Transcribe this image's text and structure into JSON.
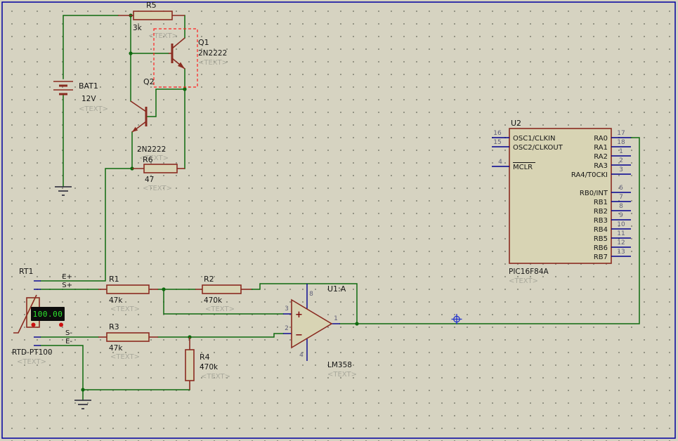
{
  "canvas": {
    "background": "#d6d3c1",
    "sheet_border_color": "#0000a0",
    "wire_color": "#0f6b0f",
    "component_color": "#8a2b20",
    "pin_color": "#00008f",
    "selection_color": "#ff2020",
    "origin_marker_color": "#2233cc",
    "lcd_text_color": "#2de52d"
  },
  "components": {
    "r5": {
      "ref": "R5",
      "value": "3k",
      "annotation": "<TEXT>"
    },
    "q1": {
      "ref": "Q1",
      "value": "2N2222",
      "annotation": "<TEXT>"
    },
    "q2": {
      "ref": "Q2",
      "value": "2N2222",
      "annotation": "<TEXT>"
    },
    "bat1": {
      "ref": "BAT1",
      "value": "12V",
      "annotation": "<TEXT>"
    },
    "r6": {
      "ref": "R6",
      "value": "47",
      "annotation": "<TEXT>"
    },
    "r1": {
      "ref": "R1",
      "value": "47k",
      "annotation": "<TEXT>"
    },
    "r2": {
      "ref": "R2",
      "value": "470k",
      "annotation": "<TEXT>"
    },
    "r3": {
      "ref": "R3",
      "value": "47k",
      "annotation": "<TEXT>"
    },
    "r4": {
      "ref": "R4",
      "value": "470k",
      "annotation": "<TEXT>"
    },
    "rt1": {
      "ref": "RT1",
      "value": "RTD-PT100",
      "annotation": "<TEXT>",
      "display_value": "100.00",
      "pins": {
        "ep": "E+",
        "sp": "S+",
        "sm": "S-",
        "em": "E-"
      }
    },
    "u1": {
      "ref": "U1:A",
      "value": "LM358",
      "annotation": "<TEXT>",
      "plus": "+",
      "minus": "−",
      "pin_numbers": {
        "noninv": "3",
        "inv": "2",
        "out": "1",
        "vcc": "8",
        "vee": "4"
      }
    },
    "u2": {
      "ref": "U2",
      "value": "PIC16F84A",
      "annotation": "<TEXT>",
      "left_pins": [
        {
          "num": "16",
          "name": "OSC1/CLKIN"
        },
        {
          "num": "15",
          "name": "OSC2/CLKOUT"
        },
        {
          "num": "4",
          "name": "MCLR"
        }
      ],
      "right_pins": [
        {
          "num": "17",
          "name": "RA0"
        },
        {
          "num": "18",
          "name": "RA1"
        },
        {
          "num": "1",
          "name": "RA2"
        },
        {
          "num": "2",
          "name": "RA3"
        },
        {
          "num": "3",
          "name": "RA4/T0CKI"
        },
        {
          "num": "6",
          "name": "RB0/INT"
        },
        {
          "num": "7",
          "name": "RB1"
        },
        {
          "num": "8",
          "name": "RB2"
        },
        {
          "num": "9",
          "name": "RB3"
        },
        {
          "num": "10",
          "name": "RB4"
        },
        {
          "num": "11",
          "name": "RB5"
        },
        {
          "num": "12",
          "name": "RB6"
        },
        {
          "num": "13",
          "name": "RB7"
        }
      ]
    }
  }
}
